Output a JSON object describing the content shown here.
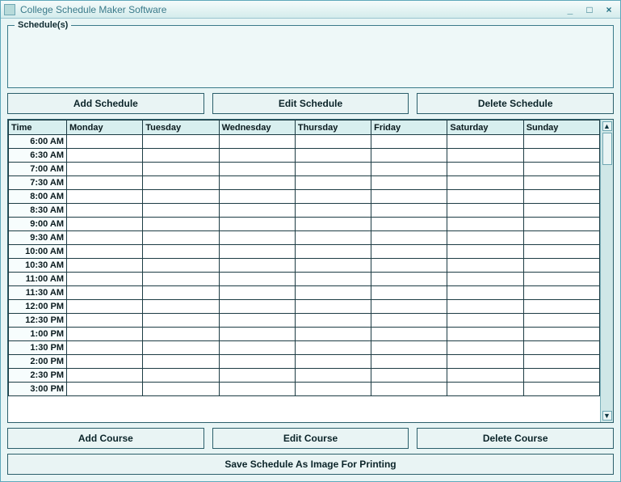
{
  "window": {
    "title": "College Schedule Maker Software",
    "minimize": "_",
    "maximize": "□",
    "close": "×"
  },
  "schedules_group": {
    "legend": "Schedule(s)"
  },
  "schedule_buttons": {
    "add": "Add Schedule",
    "edit": "Edit Schedule",
    "delete": "Delete Schedule"
  },
  "grid": {
    "headers": [
      "Time",
      "Monday",
      "Tuesday",
      "Wednesday",
      "Thursday",
      "Friday",
      "Saturday",
      "Sunday"
    ],
    "times": [
      "6:00 AM",
      "6:30 AM",
      "7:00 AM",
      "7:30 AM",
      "8:00 AM",
      "8:30 AM",
      "9:00 AM",
      "9:30 AM",
      "10:00 AM",
      "10:30 AM",
      "11:00 AM",
      "11:30 AM",
      "12:00 PM",
      "12:30 PM",
      "1:00 PM",
      "1:30 PM",
      "2:00 PM",
      "2:30 PM",
      "3:00 PM"
    ]
  },
  "course_buttons": {
    "add": "Add Course",
    "edit": "Edit Course",
    "delete": "Delete Course"
  },
  "save_button": "Save Schedule As Image For Printing"
}
